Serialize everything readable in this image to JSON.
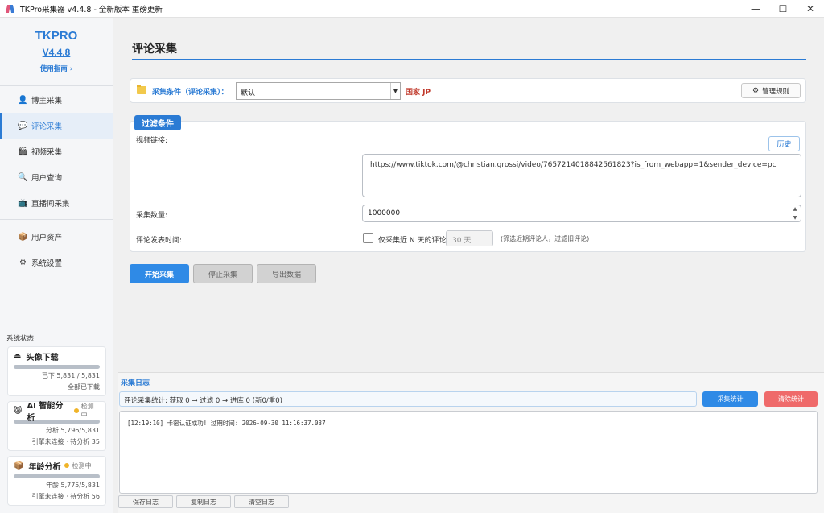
{
  "window": {
    "title": "TKPro采集器 v4.4.8 - 全新版本 重磅更新",
    "controls": {
      "minimize": "—",
      "maximize": "☐",
      "close": "✕"
    }
  },
  "sidebar": {
    "brand": "TKPRO",
    "version": "V4.4.8",
    "guide": "使用指南 ›",
    "nav_main": [
      {
        "label": "博主采集",
        "icon": "user-icon",
        "glyph": "👤",
        "active": false
      },
      {
        "label": "评论采集",
        "icon": "comment-icon",
        "glyph": "💬",
        "active": true
      },
      {
        "label": "视频采集",
        "icon": "video-icon",
        "glyph": "🎬",
        "active": false
      },
      {
        "label": "用户查询",
        "icon": "search-icon",
        "glyph": "🔍",
        "active": false
      },
      {
        "label": "直播间采集",
        "icon": "live-room-icon",
        "glyph": "📺",
        "active": false
      }
    ],
    "nav_secondary": [
      {
        "label": "用户资产",
        "icon": "assets-icon",
        "glyph": "📦"
      },
      {
        "label": "系统设置",
        "icon": "settings-icon",
        "glyph": "⚙"
      }
    ],
    "system_status_title": "系统状态",
    "cards": {
      "avatar": {
        "title": "头像下载",
        "line1": "已下 5,831 / 5,831",
        "line2": "全部已下载",
        "progress": 1.0
      },
      "ai": {
        "title": "AI 智能分析",
        "status": "检测中",
        "line1": "分析 5,796/5,831",
        "line2": "引擎未连接 · 待分析 35",
        "progress": 0.994
      },
      "age": {
        "title": "年龄分析",
        "status": "检测中",
        "line1": "年龄 5,775/5,831",
        "line2": "引擎未连接 · 待分析 56",
        "progress": 0.99
      }
    }
  },
  "main": {
    "page_title": "评论采集",
    "condition": {
      "label": "采集条件（评论采集）：",
      "selected": "默认",
      "country": "国家 JP",
      "manage_rules": "管理规则"
    },
    "filter": {
      "tag": "过滤条件",
      "video_link_label": "视频链接:",
      "history_btn": "历史",
      "video_url": "https://www.tiktok.com/@christian.grossi/video/7657214018842561823?is_from_webapp=1&sender_device=pc",
      "count_label": "采集数量:",
      "count_value": "1000000",
      "time_label": "评论发表时间:",
      "recent_checkbox_label": "仅采集近 N 天的评论",
      "days_placeholder": "30 天",
      "hint": "(筛选近期评论人，过滤旧评论)"
    },
    "actions": {
      "start": "开始采集",
      "stop": "停止采集",
      "export": "导出数据"
    }
  },
  "log": {
    "title": "采集日志",
    "stats": "评论采集统计: 获取 0 → 过滤 0 → 进库 0 (新0/重0)",
    "stats_btn": "采集统计",
    "clear_stats_btn": "清除统计",
    "lines": [
      "[12:19:10] 卡密认证成功! 过期时间: 2026-09-30 11:16:37.037"
    ],
    "footer": {
      "save": "保存日志",
      "copy": "复制日志",
      "clear": "清空日志"
    }
  },
  "colors": {
    "accent": "#2b7bd4",
    "danger": "#ef6a6a",
    "country": "#c0392b",
    "status_dot": "#f0b429"
  }
}
